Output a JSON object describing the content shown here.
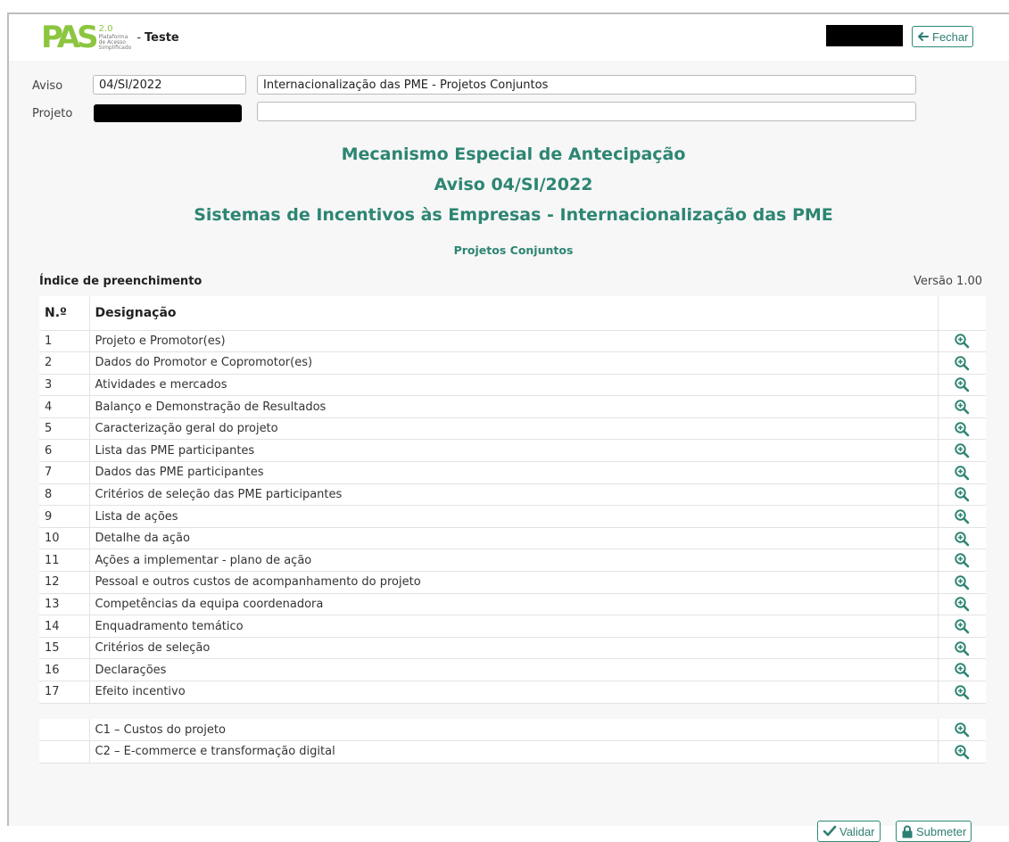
{
  "header": {
    "logo_text": "PAS",
    "logo_version": "2.0",
    "logo_sub1": "Plataforma",
    "logo_sub2": "de Acesso",
    "logo_sub3": "Simplificado",
    "dash": "-",
    "env": "Teste",
    "close_label": "Fechar"
  },
  "form": {
    "aviso_label": "Aviso",
    "aviso_code": "04/SI/2022",
    "aviso_desc": "Internacionalização das PME - Projetos Conjuntos",
    "projeto_label": "Projeto",
    "projeto_desc": ""
  },
  "titles": {
    "t1": "Mecanismo Especial de Antecipação",
    "t2": "Aviso 04/SI/2022",
    "t3": "Sistemas de Incentivos às Empresas - Internacionalização das PME",
    "t4": "Projetos Conjuntos"
  },
  "index": {
    "title": "Índice de preenchimento",
    "version": "Versão 1.00",
    "col_num": "N.º",
    "col_name": "Designação",
    "rows": [
      {
        "n": "1",
        "name": "Projeto e Promotor(es)"
      },
      {
        "n": "2",
        "name": "Dados do Promotor e Copromotor(es)"
      },
      {
        "n": "3",
        "name": "Atividades e mercados"
      },
      {
        "n": "4",
        "name": "Balanço e Demonstração de Resultados"
      },
      {
        "n": "5",
        "name": "Caracterização geral do projeto"
      },
      {
        "n": "6",
        "name": "Lista das PME participantes"
      },
      {
        "n": "7",
        "name": "Dados das PME participantes"
      },
      {
        "n": "8",
        "name": "Critérios de seleção das PME participantes"
      },
      {
        "n": "9",
        "name": "Lista de ações"
      },
      {
        "n": "10",
        "name": "Detalhe da ação"
      },
      {
        "n": "11",
        "name": "Ações a implementar - plano de ação"
      },
      {
        "n": "12",
        "name": "Pessoal e outros custos de acompanhamento do projeto"
      },
      {
        "n": "13",
        "name": "Competências da equipa coordenadora"
      },
      {
        "n": "14",
        "name": "Enquadramento temático"
      },
      {
        "n": "15",
        "name": "Critérios de seleção"
      },
      {
        "n": "16",
        "name": "Declarações"
      },
      {
        "n": "17",
        "name": "Efeito incentivo"
      }
    ],
    "extra_rows": [
      {
        "n": "",
        "name": "C1 – Custos do projeto"
      },
      {
        "n": "",
        "name": "C2 – E-commerce e transformação digital"
      }
    ]
  },
  "actions": {
    "validate_label": "Validar",
    "submit_label": "Submeter"
  },
  "colors": {
    "accent": "#2d8573",
    "logo_green": "#8cc63f"
  },
  "icons": {
    "row_action": "zoom-in-icon",
    "close": "arrow-left-icon",
    "validate": "check-icon",
    "submit": "lock-icon"
  }
}
